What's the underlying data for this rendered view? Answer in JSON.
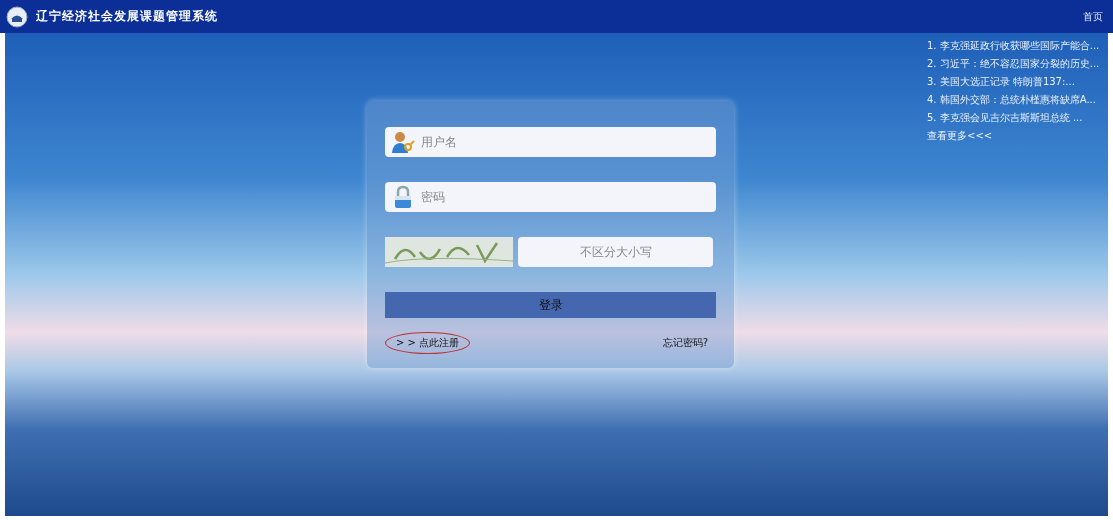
{
  "header": {
    "title": "辽宁经济社会发展课题管理系统",
    "home_link": "首页"
  },
  "news": {
    "items": [
      {
        "text": "1. 李克强延政行收获哪些国际产能合..."
      },
      {
        "text": "2. 习近平：绝不容忍国家分裂的历史..."
      },
      {
        "text": "3. 美国大选正记录 特朗普137:..."
      },
      {
        "text": "4. 韩国外交部：总统朴槿惠将缺席A..."
      },
      {
        "text": "5. 李克强会见吉尔吉斯斯坦总统 ..."
      }
    ],
    "more": "查看更多<<<"
  },
  "login": {
    "username": {
      "placeholder": "用户名"
    },
    "password": {
      "placeholder": "密码"
    },
    "captcha": {
      "placeholder": "不区分大小写"
    },
    "submit": "登录",
    "register_link": "> > 点此注册",
    "forgot_link": "忘记密码?"
  }
}
